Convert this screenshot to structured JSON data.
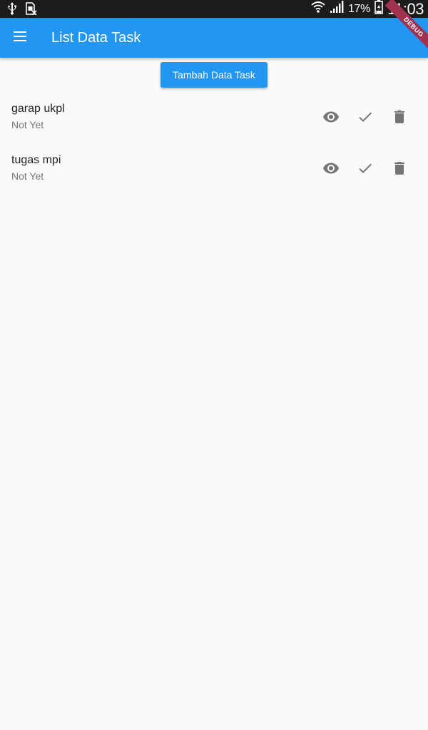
{
  "status_bar": {
    "battery_percent": "17%",
    "time": "11:03",
    "icons": [
      "usb-icon",
      "sim-icon",
      "wifi-icon",
      "signal-icon",
      "battery-icon"
    ]
  },
  "app_bar": {
    "title": "List Data Task",
    "menu_icon": "menu-icon",
    "background": "#2196f3"
  },
  "add_button": {
    "label": "Tambah Data Task"
  },
  "tasks": [
    {
      "title": "garap ukpl",
      "status": "Not Yet",
      "actions": [
        "view-icon",
        "check-icon",
        "delete-icon"
      ]
    },
    {
      "title": "tugas mpi",
      "status": "Not Yet",
      "actions": [
        "view-icon",
        "check-icon",
        "delete-icon"
      ]
    }
  ],
  "colors": {
    "primary": "#2196f3",
    "icon_gray": "#757575",
    "background": "#fafafa"
  }
}
